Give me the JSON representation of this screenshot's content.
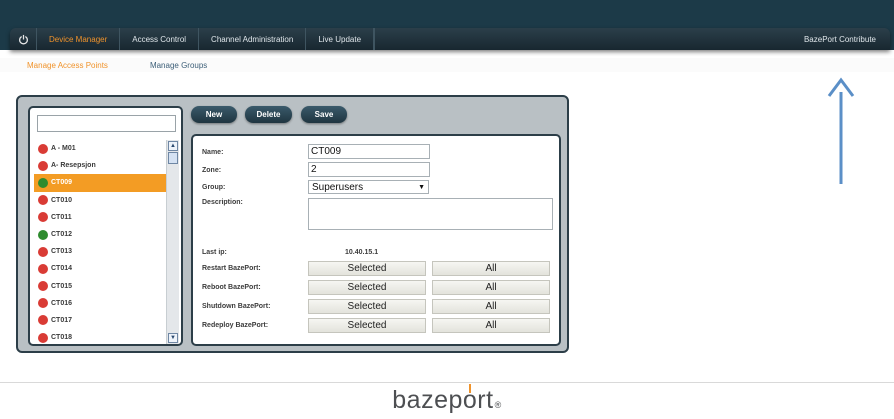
{
  "nav": {
    "power_icon": "power-icon",
    "items": [
      {
        "label": "Device Manager",
        "active": true
      },
      {
        "label": "Access Control",
        "active": false
      },
      {
        "label": "Channel Administration",
        "active": false
      },
      {
        "label": "Live Update",
        "active": false
      }
    ],
    "right_label": "BazePort Contribute"
  },
  "subnav": {
    "items": [
      {
        "label": "Manage Access Points",
        "active": true
      },
      {
        "label": "Manage Groups",
        "active": false
      }
    ]
  },
  "search": {
    "value": "",
    "placeholder": ""
  },
  "device_list": {
    "items": [
      {
        "label": "A - M01",
        "status": "red"
      },
      {
        "label": "A- Resepsjon",
        "status": "red"
      },
      {
        "label": "CT009",
        "status": "green",
        "selected": true
      },
      {
        "label": "CT010",
        "status": "red"
      },
      {
        "label": "CT011",
        "status": "red"
      },
      {
        "label": "CT012",
        "status": "green"
      },
      {
        "label": "CT013",
        "status": "red"
      },
      {
        "label": "CT014",
        "status": "red"
      },
      {
        "label": "CT015",
        "status": "red"
      },
      {
        "label": "CT016",
        "status": "red"
      },
      {
        "label": "CT017",
        "status": "red"
      },
      {
        "label": "CT018",
        "status": "red"
      }
    ],
    "status_colors": {
      "red": "#d93b35",
      "green": "#2e8b2e"
    }
  },
  "actions": {
    "new": "New",
    "delete": "Delete",
    "save": "Save"
  },
  "form": {
    "name_label": "Name:",
    "name_value": "CT009",
    "zone_label": "Zone:",
    "zone_value": "2",
    "group_label": "Group:",
    "group_value": "Superusers",
    "description_label": "Description:",
    "description_value": "",
    "lastip_label": "Last ip:",
    "lastip_value": "10.40.15.1",
    "commands": [
      {
        "label": "Restart BazePort:",
        "selected": "Selected",
        "all": "All"
      },
      {
        "label": "Reboot BazePort:",
        "selected": "Selected",
        "all": "All"
      },
      {
        "label": "Shutdown BazePort:",
        "selected": "Selected",
        "all": "All"
      },
      {
        "label": "Redeploy BazePort:",
        "selected": "Selected",
        "all": "All"
      }
    ]
  },
  "footer": {
    "logo_text_a": "bazep",
    "logo_text_o": "o",
    "logo_text_b": "rt",
    "logo_reg": "®"
  },
  "colors": {
    "accent": "#f0932b",
    "navbar": "#1c3a48",
    "selected_row": "#f39c24"
  }
}
